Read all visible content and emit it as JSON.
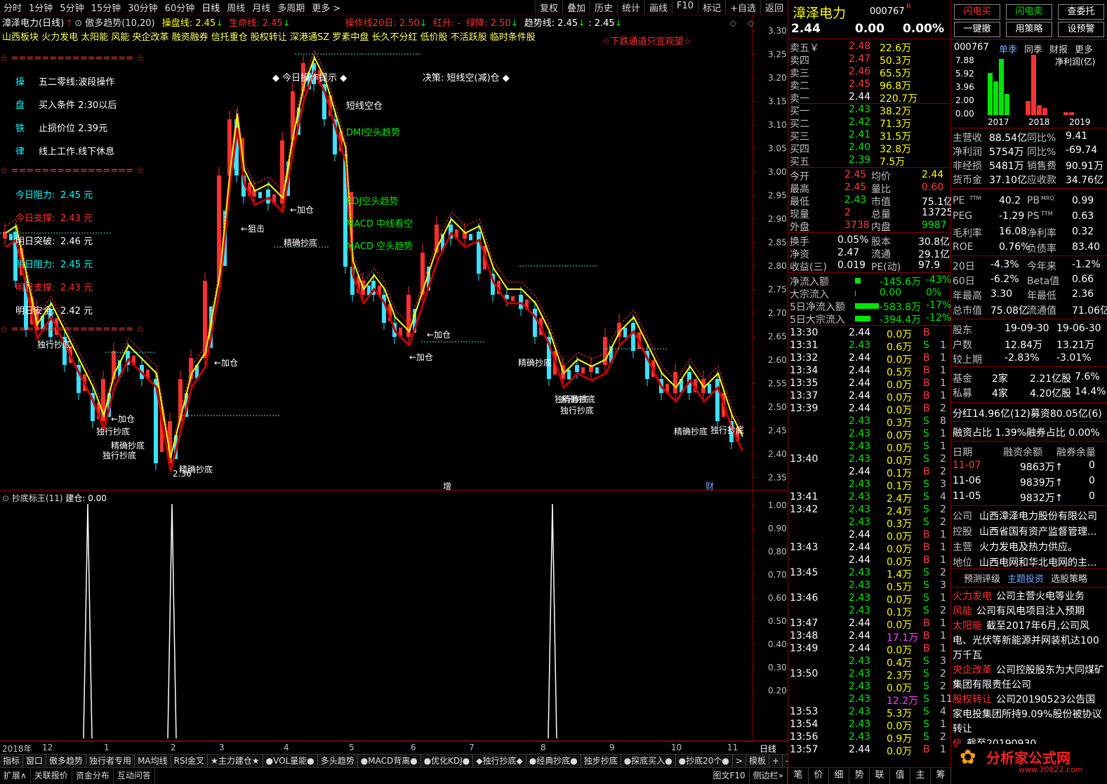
{
  "topbar": {
    "periods": [
      "分时",
      "1分钟",
      "5分钟",
      "15分钟",
      "30分钟",
      "60分钟",
      "日线",
      "周线",
      "月线",
      "多周期",
      "更多 >"
    ],
    "active": "日线",
    "tools": [
      "复权",
      "叠加",
      "历史",
      "统计",
      "画线",
      "F10",
      "标记",
      "+自选",
      "返回"
    ]
  },
  "main": {
    "title": "漳泽电力(日线)",
    "indicator": "傲多趋势(10,20)",
    "caopanxian": "操盘线: 2.45",
    "shengmingxian": "生命线: 2.45",
    "caozuo20": "操作线20日: 2.50",
    "hongsheng": "红升: -",
    "lvjiang": "绿降: 2.50",
    "qushi": "趋势线: 2.45",
    "qushi2": ": 2.45",
    "concepts": "山西板块 火力发电 太阳能 风能 央企改革 融资融券 信托重仓 股权转让 深港通SZ 罗素中盘 长久不分红 低价股 不活跃股 临时条件股",
    "warn": "☆下跌通道只宜观望☆",
    "yticks": [
      "3.30",
      "3.25",
      "3.20",
      "3.15",
      "3.10",
      "3.05",
      "3.00",
      "2.95",
      "2.90",
      "2.85",
      "2.80",
      "2.75",
      "2.70",
      "2.65",
      "2.60",
      "2.55",
      "2.50",
      "2.45",
      "2.40",
      "2.35"
    ],
    "stars": "☆ ================ ☆",
    "ops": [
      {
        "k": "操",
        "v": "五二零线:波段操作"
      },
      {
        "k": "盘",
        "v": "买入条件 2:30以后"
      },
      {
        "k": "铁",
        "v": "止损价位 2.39元"
      },
      {
        "k": "律",
        "v": "线上工作.线下休息"
      }
    ],
    "levels": [
      {
        "k": "今日阻力:",
        "v": "2.45 元"
      },
      {
        "k": "今日支撑:",
        "v": "2.43 元"
      },
      {
        "k": "明日突破:",
        "v": "2.46 元"
      },
      {
        "k": "明日阻力:",
        "v": "2.45 元"
      },
      {
        "k": "明日支撑:",
        "v": "2.43 元"
      },
      {
        "k": "明日安全:",
        "v": "2.42 元"
      }
    ],
    "tips": "◆ 今日操作提示 ◆",
    "decision": "决策: 短线空(减)仓 ◆",
    "signals": [
      "短线空仓",
      "DMI空头趋势",
      "KDJ空头趋势",
      "MACD 中线看空",
      "MACD 空头趋势"
    ],
    "annotations": [
      "独行抄底",
      "←加仓",
      "独行抄底",
      "精确抄底",
      "独行抄底",
      "←加仓",
      "精确抄底",
      "2.36",
      "←加仓",
      "←狙击",
      "←加仓",
      "精确抄底",
      "←加仓",
      "精确抄底",
      "独行抄底",
      "独行抄底",
      "精确抄底",
      "独行抄底",
      "精确抄底"
    ],
    "marks": [
      "增",
      "财"
    ]
  },
  "sub": {
    "title": "抄底标王(11)",
    "jiancang": "建仓: 0.00",
    "yticks": [
      "1.00",
      "0.90",
      "0.80",
      "0.70",
      "0.60",
      "0.50",
      "0.40",
      "0.30",
      "0.20"
    ]
  },
  "datebar": {
    "labels": [
      "2018年",
      "12",
      "1",
      "2",
      "3",
      "4",
      "5",
      "6",
      "7",
      "8",
      "9",
      "10",
      "11"
    ],
    "right": "日线"
  },
  "tabs": [
    "指标",
    "窗口",
    "傲多趋势",
    "独行者专用",
    "MA均线",
    "RSI金叉",
    "★主力建仓★",
    "●VOL量能●",
    "多头趋势",
    "●MACD背离●",
    "●优化KDJ●",
    "◆独行抄底◆",
    "●经典抄底●",
    "独步抄底",
    "●探底买入●",
    "●抄底20个●",
    ">",
    "模板",
    "+",
    "-"
  ],
  "status": [
    "扩展∧",
    "关联报价",
    "资金分布",
    "互动问答"
  ],
  "status_right": [
    "图文F10",
    "侧边栏»"
  ],
  "quote": {
    "name": "漳泽电力",
    "code": "000767",
    "r": "R",
    "price": "2.44",
    "chg": "0.00",
    "pct": "0.00%",
    "asks": [
      {
        "l": "卖五￥",
        "p": "2.48",
        "v": "22.6万"
      },
      {
        "l": "卖四",
        "p": "2.47",
        "v": "50.3万"
      },
      {
        "l": "卖三",
        "p": "2.46",
        "v": "65.5万"
      },
      {
        "l": "卖二",
        "p": "2.45",
        "v": "96.8万"
      },
      {
        "l": "卖一",
        "p": "2.44",
        "v": "220.7万"
      }
    ],
    "bids": [
      {
        "l": "买一",
        "p": "2.43",
        "v": "38.2万"
      },
      {
        "l": "买二",
        "p": "2.42",
        "v": "71.3万"
      },
      {
        "l": "买三",
        "p": "2.41",
        "v": "31.5万"
      },
      {
        "l": "买四",
        "p": "2.40",
        "v": "32.8万"
      },
      {
        "l": "买五",
        "p": "2.39",
        "v": "7.5万"
      }
    ],
    "stats": [
      {
        "a": "今开",
        "av": "2.45",
        "b": "均价",
        "bv": "2.44"
      },
      {
        "a": "最高",
        "av": "2.45",
        "b": "量比",
        "bv": "0.60"
      },
      {
        "a": "最低",
        "av": "2.43",
        "b": "市值",
        "bv": "75.1亿"
      },
      {
        "a": "现量",
        "av": "2",
        "b": "总量",
        "bv": "13725"
      },
      {
        "a": "外盘",
        "av": "3738",
        "b": "内盘",
        "bv": "9987"
      }
    ],
    "stats2": [
      {
        "a": "换手",
        "av": "0.05%",
        "b": "股本",
        "bv": "30.8亿"
      },
      {
        "a": "净资",
        "av": "2.47",
        "b": "流通",
        "bv": "29.1亿"
      },
      {
        "a": "收益(三)",
        "av": "0.019",
        "b": "PE(动)",
        "bv": "97.9"
      }
    ],
    "flows": [
      {
        "l": "净流入额",
        "v": "-145.6万",
        "p": "-43%",
        "w": 8
      },
      {
        "l": "大宗流入",
        "v": "0.00",
        "p": "0%",
        "w": 1
      },
      {
        "l": "5日净流入额",
        "v": "-583.8万",
        "p": "-17%",
        "w": 34
      },
      {
        "l": "5日大宗流入",
        "v": "-394.4万",
        "p": "-12%",
        "w": 22
      }
    ],
    "ticks": [
      [
        "13:30",
        "2.44",
        "0.0万",
        "B",
        ""
      ],
      [
        "13:31",
        "2.43",
        "0.6万",
        "S",
        "1"
      ],
      [
        "13:32",
        "2.44",
        "0.0万",
        "B",
        "1"
      ],
      [
        "13:34",
        "2.44",
        "0.5万",
        "B",
        "1"
      ],
      [
        "13:35",
        "2.44",
        "0.0万",
        "B",
        "1"
      ],
      [
        "13:37",
        "2.44",
        "0.0万",
        "B",
        "1"
      ],
      [
        "13:39",
        "2.44",
        "0.0万",
        "B",
        "2"
      ],
      [
        "",
        "2.43",
        "0.3万",
        "S",
        "8"
      ],
      [
        "",
        "2.43",
        "0.0万",
        "S",
        "1"
      ],
      [
        "",
        "2.43",
        "0.0万",
        "S",
        "1"
      ],
      [
        "13:40",
        "2.43",
        "0.0万",
        "S",
        "2"
      ],
      [
        "",
        "2.44",
        "0.1万",
        "B",
        "2"
      ],
      [
        "",
        "2.43",
        "0.1万",
        "S",
        "3"
      ],
      [
        "13:41",
        "2.43",
        "2.4万",
        "S",
        "4"
      ],
      [
        "13:42",
        "2.43",
        "2.4万",
        "S",
        "2"
      ],
      [
        "",
        "2.43",
        "0.3万",
        "S",
        "2"
      ],
      [
        "",
        "2.44",
        "0.0万",
        "B",
        "1"
      ],
      [
        "13:43",
        "2.44",
        "0.0万",
        "B",
        "1"
      ],
      [
        "",
        "2.44",
        "0.0万",
        "B",
        "1"
      ],
      [
        "13:45",
        "2.43",
        "1.4万",
        "S",
        "2"
      ],
      [
        "",
        "2.43",
        "0.5万",
        "S",
        "3"
      ],
      [
        "13:46",
        "2.43",
        "0.0万",
        "S",
        "1"
      ],
      [
        "",
        "2.43",
        "0.1万",
        "S",
        "2"
      ],
      [
        "13:47",
        "2.44",
        "0.0万",
        "B",
        "1"
      ],
      [
        "13:48",
        "2.44",
        "17.1万",
        "B",
        "1"
      ],
      [
        "13:49",
        "2.44",
        "0.0万",
        "B",
        "1"
      ],
      [
        "",
        "2.43",
        "0.4万",
        "S",
        "3"
      ],
      [
        "13:50",
        "2.43",
        "2.3万",
        "S",
        "2"
      ],
      [
        "",
        "2.43",
        "0.0万",
        "S",
        "2"
      ],
      [
        "",
        "2.43",
        "12.2万",
        "S",
        "11"
      ],
      [
        "13:53",
        "2.43",
        "5.3万",
        "S",
        "4"
      ],
      [
        "13:54",
        "2.43",
        "0.0万",
        "S",
        "1"
      ],
      [
        "13:56",
        "2.43",
        "0.9万",
        "S",
        "2"
      ],
      [
        "13:57",
        "2.44",
        "0.0万",
        "B",
        "1"
      ]
    ],
    "bottom": [
      "笔",
      "价",
      "细",
      "势",
      "联",
      "值",
      "主",
      "筹"
    ]
  },
  "f10": {
    "buttons": [
      "闪电买",
      "闪电卖",
      "查委托",
      "一键撤",
      "用策略",
      "设预警"
    ],
    "head": {
      "code": "000767",
      "tabs": [
        "单季",
        "同季",
        "财报",
        "更多"
      ]
    },
    "chart": {
      "ylabels": [
        "7.88",
        "5.92",
        "3.96",
        "2.00",
        "0.00"
      ],
      "legend": "净利润(亿)",
      "years": [
        "2017",
        "2018",
        "2019"
      ]
    },
    "fin": [
      {
        "a": "主营收",
        "av": "88.54亿",
        "b": "同比%",
        "bv": "9.41"
      },
      {
        "a": "净利润",
        "av": "5754万",
        "b": "同比%",
        "bv": "-69.74"
      },
      {
        "a": "非经损",
        "av": "5481万",
        "b": "销售费",
        "bv": "90.91万"
      },
      {
        "a": "货币金",
        "av": "37.10亿",
        "b": "应收款",
        "bv": "34.76亿"
      }
    ],
    "val": [
      {
        "a": "PE",
        "at": "TTM",
        "av": "40.2",
        "b": "PB",
        "bt": "MRQ",
        "bv": "0.99"
      },
      {
        "a": "PEG",
        "at": "",
        "av": "-1.29",
        "b": "PS",
        "bt": "TTM",
        "bv": "0.63"
      },
      {
        "a": "毛利率",
        "at": "",
        "av": "16.08",
        "b": "净利率",
        "bt": "",
        "bv": "0.32"
      },
      {
        "a": "ROE",
        "at": "",
        "av": "0.76%",
        "b": "负债率",
        "bt": "",
        "bv": "83.40"
      }
    ],
    "perf": [
      {
        "a": "20日",
        "av": "-4.3%",
        "b": "今年来",
        "bv": "-1.2%"
      },
      {
        "a": "60日",
        "av": "-6.2%",
        "b": "Beta值",
        "bv": "0.66"
      },
      {
        "a": "年最高",
        "av": "3.30",
        "b": "年最低",
        "bv": "2.36"
      },
      {
        "a": "总市值",
        "av": "75.08亿",
        "b": "流通值",
        "bv": "71.06亿"
      }
    ],
    "holders": [
      {
        "a": "股东",
        "av": "19-09-30",
        "bv": "19-06-30"
      },
      {
        "a": "户数",
        "av": "12.84万",
        "bv": "13.21万"
      },
      {
        "a": "较上期",
        "av": "-2.83%",
        "bv": "-3.01%"
      }
    ],
    "funds": [
      {
        "a": "基金",
        "av": "2家",
        "b": "2.21亿股",
        "bv": "7.6%"
      },
      {
        "a": "私募",
        "av": "4家",
        "b": "4.20亿股",
        "bv": "14.4%"
      }
    ],
    "div": "分红14.96亿(12)募资80.05亿(6)",
    "margin": "融资占比 1.39%融券占比 0.00%",
    "mhead": [
      "日期",
      "融资余额",
      "融券余量"
    ],
    "mrows": [
      [
        "11-07",
        "9863万↑",
        "0"
      ],
      [
        "11-06",
        "9839万↑",
        "0"
      ],
      [
        "11-05",
        "9832万↑",
        "0"
      ]
    ],
    "comp": [
      {
        "k": "公司",
        "v": "山西漳泽电力股份有限公司"
      },
      {
        "k": "控股",
        "v": "山西省国有资产监督管理..."
      },
      {
        "k": "主营",
        "v": "火力发电及热力供应。"
      },
      {
        "k": "地位",
        "v": "山西电网和华北电网的主..."
      }
    ],
    "tabs2": [
      "预测评级",
      "主题投资",
      "选股策略"
    ],
    "themes": [
      {
        "k": "火力发电",
        "v": "公司主营火电等业务"
      },
      {
        "k": "风能",
        "v": "公司有风电项目注入预期"
      },
      {
        "k": "太阳能",
        "v": "截至2017年6月,公司风电、光伏等新能源并网装机达100万千瓦"
      },
      {
        "k": "央企改革",
        "v": "公司控股股东为大同煤矿集团有限责任公司"
      },
      {
        "k": "股权转让",
        "v": "公司20190523公告国家电投集团所持9.09%股份被协议转让"
      },
      {
        "k": "信",
        "v": "截至20190930..."
      }
    ],
    "logo": "分析家公式网",
    "logo_url": "www.70822.com"
  }
}
